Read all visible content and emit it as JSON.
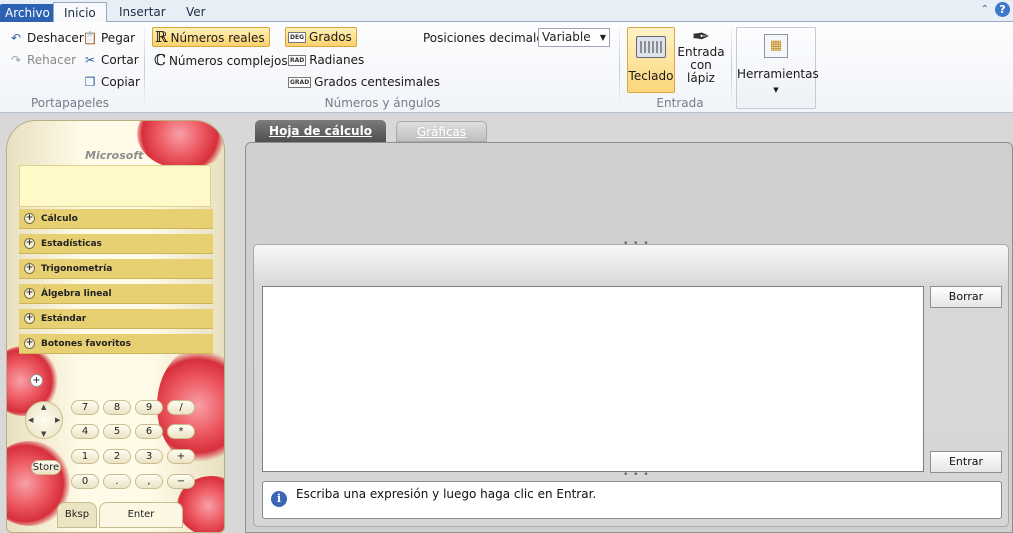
{
  "ribbon": {
    "tabs": [
      "Archivo",
      "Inicio",
      "Insertar",
      "Ver"
    ],
    "clipboard": {
      "undo": "Deshacer",
      "redo": "Rehacer",
      "paste": "Pegar",
      "cut": "Cortar",
      "copy": "Copiar",
      "group": "Portapapeles"
    },
    "numbers": {
      "real": "Números reales",
      "complex": "Números complejos",
      "degrees": "Grados",
      "radians": "Radianes",
      "gradians": "Grados centesimales",
      "decimals_label": "Posiciones decimales",
      "decimals_value": "Variable",
      "group": "Números y ángulos",
      "deg_tag": "DEG",
      "rad_tag": "RAD",
      "grad_tag": "GRAD",
      "real_symbol": "ℝ",
      "complex_symbol": "ℂ"
    },
    "input": {
      "keyboard": "Teclado",
      "pen_line1": "Entrada",
      "pen_line2": "con lápiz",
      "group": "Entrada"
    },
    "tools": {
      "label": "Herramientas"
    },
    "help": "?"
  },
  "calculator": {
    "brand": "Microsoft",
    "categories": [
      "Cálculo",
      "Estadísticas",
      "Trigonometría",
      "Álgebra lineal",
      "Estándar",
      "Botones favoritos"
    ],
    "keys": {
      "row1": [
        "7",
        "8",
        "9",
        "/"
      ],
      "row2": [
        "4",
        "5",
        "6",
        "*"
      ],
      "row3": [
        "1",
        "2",
        "3",
        "+"
      ],
      "row4": [
        "0",
        ".",
        ",",
        "−"
      ],
      "store": "Store",
      "bksp": "Bksp",
      "enter": "Enter"
    }
  },
  "workspace": {
    "tabs": [
      "Hoja de cálculo",
      "Gráficas"
    ],
    "clear_button": "Borrar",
    "enter_button": "Entrar",
    "status_message": "Escriba una expresión y luego haga clic en Entrar."
  },
  "colors": {
    "accent_blue": "#2d62b3",
    "selected_button": "#fcd26c",
    "calc_category": "#e6d072",
    "flower_red": "#d62f3c"
  }
}
